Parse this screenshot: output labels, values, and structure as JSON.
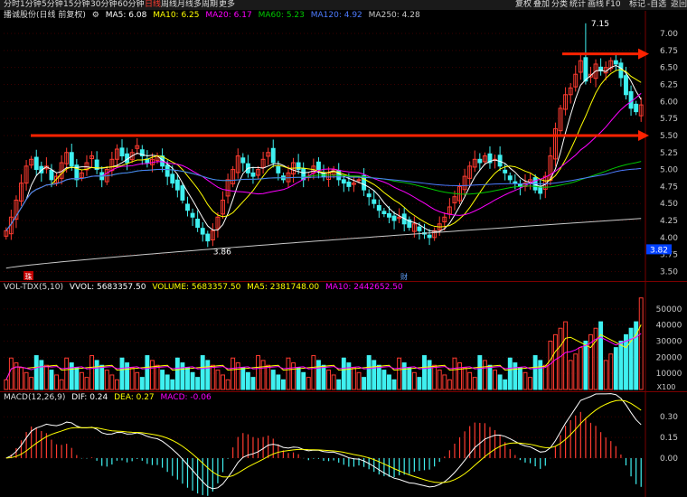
{
  "toolbar": {
    "periods": [
      "分时",
      "1分钟",
      "5分钟",
      "15分钟",
      "30分钟",
      "60分钟",
      "日线",
      "周线",
      "月线",
      "多周期",
      "更多"
    ],
    "active": "日线",
    "right": [
      "复权",
      "叠加",
      "分类",
      "统计",
      "画线",
      "F10",
      "标记",
      "-自选",
      "返回"
    ]
  },
  "main_legend": {
    "title": "播诚股份(日线 前复权)",
    "ma5": "MA5: 6.08",
    "ma10": "MA10: 6.25",
    "ma20": "MA20: 6.17",
    "ma60": "MA60: 5.23",
    "ma120": "MA120: 4.92",
    "ma250": "MA250: 4.28"
  },
  "vol_legend": {
    "title": "VOL-TDX(5,10)",
    "vvol": "VVOL: 5683357.50",
    "volume": "VOLUME: 5683357.50",
    "ma5": "MA5: 2381748.00",
    "ma10": "MA10: 2442652.50"
  },
  "macd_legend": {
    "title": "MACD(12,26,9)",
    "dif": "DIF: 0.24",
    "dea": "DEA: 0.27",
    "macd": "MACD: -0.06"
  },
  "annotations": {
    "high_label": "7.15",
    "low_label": "3.86",
    "current_price_badge": "3.82",
    "marker_left": "珠",
    "marker_mid": "财",
    "vol_unit": "X100"
  },
  "colors": {
    "up": "#ff3b30",
    "down": "#3ff0f0",
    "ma5": "#ffffff",
    "ma10": "#ffff00",
    "ma20": "#ff00ff",
    "ma60": "#00c800",
    "ma120": "#4d7bff",
    "ma250": "#c8c8c8",
    "arrow": "#ff2200"
  },
  "chart_data": [
    {
      "type": "candlestick",
      "title": "播诚股份(日线 前复权)",
      "y_ticks": [
        3.5,
        3.75,
        4.0,
        4.25,
        4.5,
        4.75,
        5.0,
        5.25,
        5.5,
        5.75,
        6.0,
        6.25,
        6.5,
        6.75,
        7.0
      ],
      "ylim": [
        3.4,
        7.2
      ],
      "closes": [
        4.1,
        4.3,
        4.55,
        4.8,
        5.05,
        5.15,
        5.0,
        4.95,
        5.05,
        4.85,
        4.9,
        5.1,
        5.25,
        5.05,
        4.85,
        4.95,
        5.1,
        5.2,
        5.0,
        4.85,
        5.0,
        5.15,
        5.3,
        5.2,
        5.1,
        5.25,
        5.35,
        5.2,
        5.1,
        5.15,
        5.2,
        5.05,
        4.9,
        4.8,
        4.7,
        4.55,
        4.4,
        4.3,
        4.15,
        4.05,
        3.95,
        4.1,
        4.3,
        4.55,
        4.85,
        5.0,
        5.2,
        5.1,
        4.95,
        4.9,
        5.0,
        5.15,
        5.25,
        5.1,
        4.95,
        4.85,
        4.95,
        5.1,
        5.0,
        4.85,
        4.9,
        5.05,
        5.0,
        4.9,
        4.95,
        5.0,
        4.85,
        4.8,
        4.75,
        4.8,
        4.85,
        4.7,
        4.6,
        4.5,
        4.4,
        4.35,
        4.3,
        4.25,
        4.3,
        4.2,
        4.15,
        4.2,
        4.1,
        4.05,
        4.0,
        4.1,
        4.2,
        4.3,
        4.45,
        4.6,
        4.75,
        4.9,
        5.05,
        5.15,
        5.1,
        5.2,
        5.1,
        5.15,
        5.05,
        4.95,
        4.85,
        4.8,
        4.75,
        4.8,
        4.85,
        4.7,
        4.65,
        4.9,
        5.2,
        5.6,
        5.9,
        6.1,
        6.2,
        6.4,
        6.6,
        6.3,
        6.4,
        6.55,
        6.45,
        6.5,
        6.6,
        6.55,
        6.35,
        6.1,
        5.9,
        5.85,
        5.95
      ],
      "highs_marked": {
        "index": 115,
        "value": 7.15
      },
      "lows_marked": {
        "index": 40,
        "value": 3.86
      },
      "ma_lines": {
        "MA5": 6.08,
        "MA10": 6.25,
        "MA20": 6.17,
        "MA60": 5.23,
        "MA120": 4.92,
        "MA250": 4.28
      },
      "horizontal_arrows": [
        5.5,
        6.7
      ]
    },
    {
      "type": "bar",
      "title": "VOL-TDX(5,10)",
      "y_ticks": [
        10000,
        20000,
        30000,
        40000,
        50000
      ],
      "ylim": [
        0,
        60000
      ],
      "last_volume": 5683357.5,
      "ma5": 2381748.0,
      "ma10": 2442652.5
    },
    {
      "type": "bar",
      "title": "MACD(12,26,9)",
      "y_ticks": [
        0.0,
        0.15,
        0.3
      ],
      "ylim": [
        -0.25,
        0.4
      ],
      "dif": 0.24,
      "dea": 0.27,
      "macd": -0.06
    }
  ]
}
